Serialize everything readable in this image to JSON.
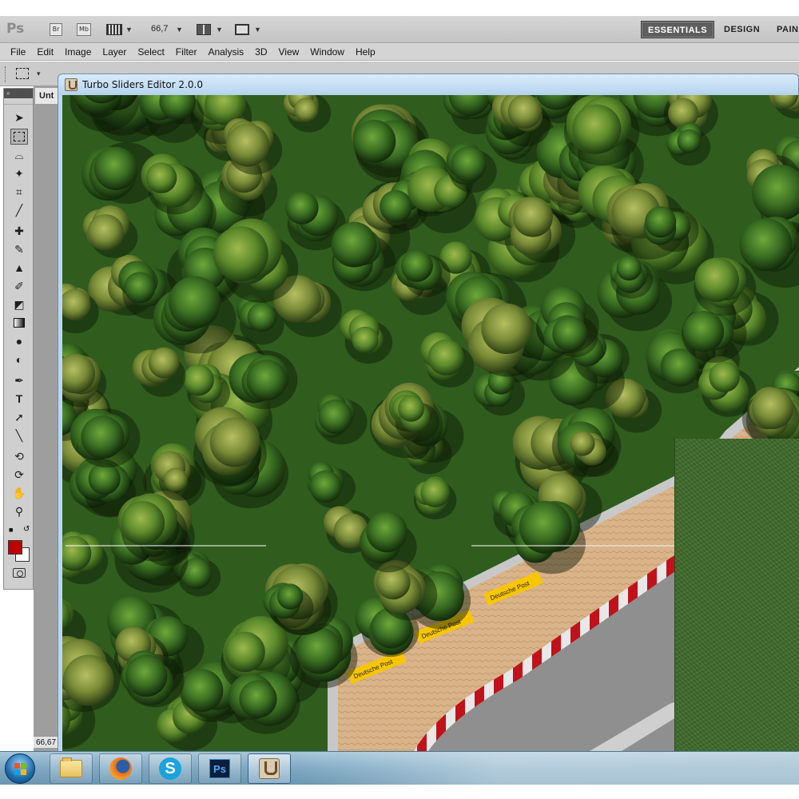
{
  "photoshop": {
    "logo": "Ps",
    "bridge_button": "Br",
    "minibridge_button": "Mb",
    "zoom_level": "66,7",
    "workspaces": [
      "ESSENTIALS",
      "DESIGN",
      "PAIN"
    ],
    "active_workspace": "ESSENTIALS",
    "menu": [
      "File",
      "Edit",
      "Image",
      "Layer",
      "Select",
      "Filter",
      "Analysis",
      "3D",
      "View",
      "Window",
      "Help"
    ],
    "document_tab": "Unt",
    "status_zoom": "66,67",
    "foreground_color": "#c00000",
    "background_color": "#ffffff",
    "panel_collapse_glyph": "»",
    "tools": [
      "move-icon",
      "rectangular-marquee-icon",
      "lasso-icon",
      "magic-wand-icon",
      "crop-icon",
      "eyedropper-icon",
      "spot-healing-icon",
      "brush-icon",
      "clone-stamp-icon",
      "history-brush-icon",
      "eraser-icon",
      "gradient-icon",
      "blur-icon",
      "dodge-icon",
      "pen-icon",
      "type-icon",
      "path-selection-icon",
      "line-icon",
      "3d-rotate-icon",
      "3d-orbit-icon",
      "hand-icon",
      "zoom-icon"
    ]
  },
  "editor": {
    "title": "Turbo Sliders Editor 2.0.0",
    "sponsor_text": "Deutsche Post"
  },
  "taskbar": {
    "apps": [
      "start-icon",
      "windows-explorer-icon",
      "firefox-icon",
      "skype-icon",
      "photoshop-icon",
      "turbo-sliders-icon"
    ],
    "photoshop_label": "Ps",
    "skype_label": "S"
  }
}
